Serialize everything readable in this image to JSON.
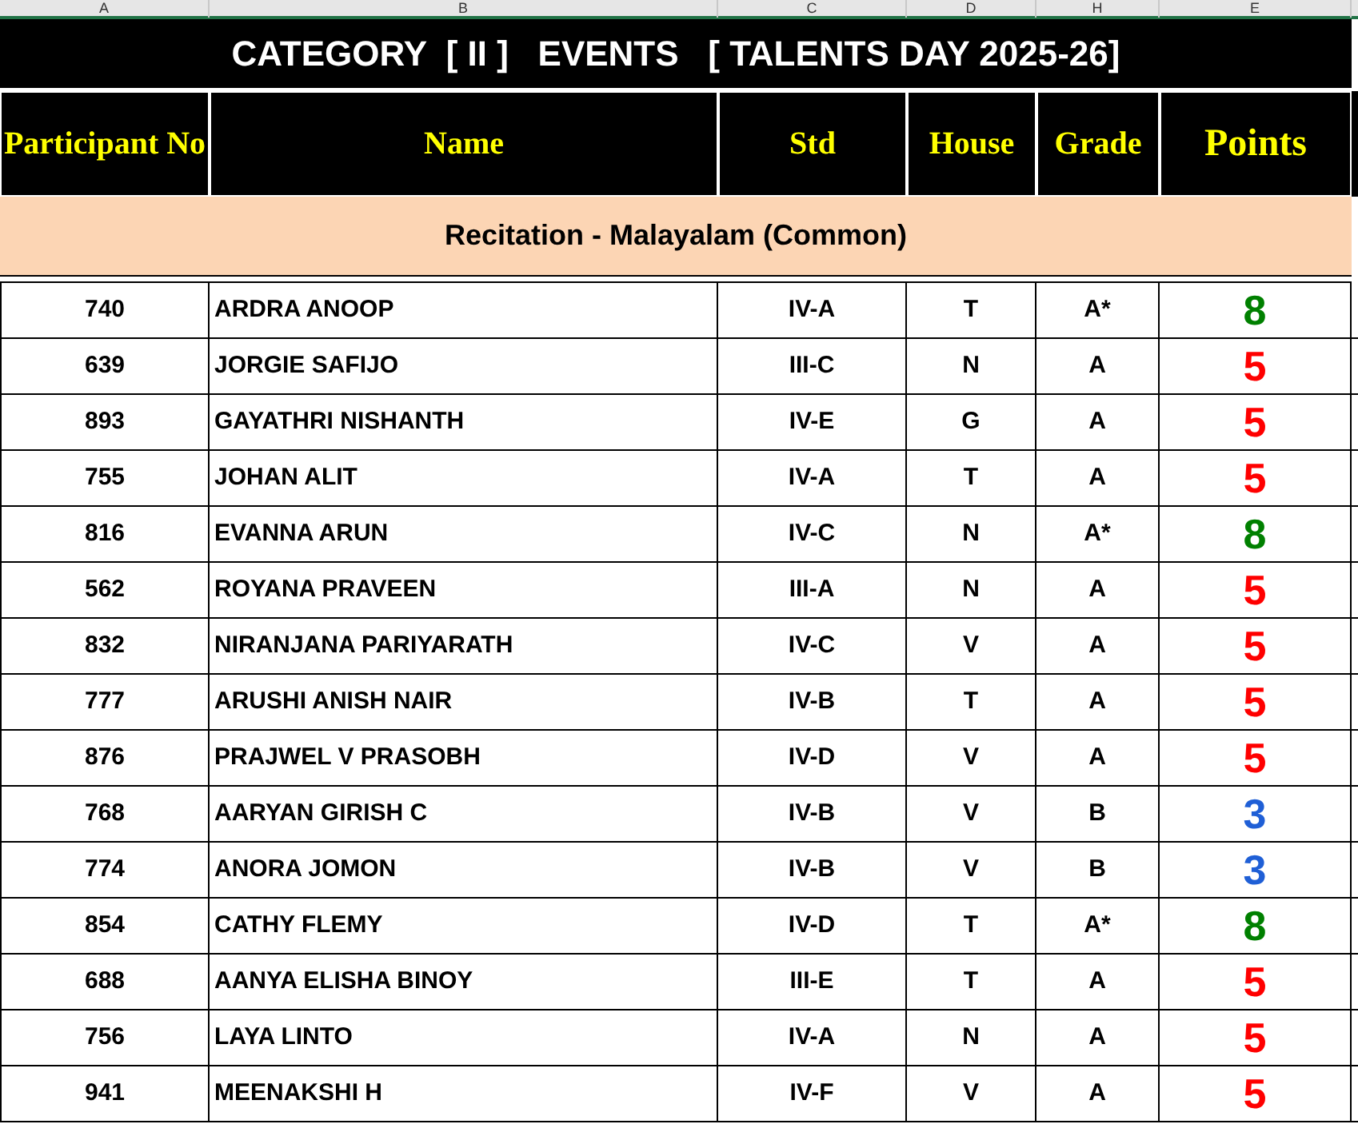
{
  "column_letters": [
    "A",
    "B",
    "C",
    "D",
    "H",
    "E"
  ],
  "title": "CATEGORY  [ II ]   EVENTS   [ TALENTS DAY 2025-26]",
  "columns": [
    "Participant No",
    "Name",
    "Std",
    "House",
    "Grade",
    "Points"
  ],
  "section": "Recitation - Malayalam (Common)",
  "rows": [
    {
      "no": "740",
      "name": "ARDRA ANOOP",
      "std": "IV-A",
      "house": "T",
      "grade": "A*",
      "points": "8",
      "color": "#008000"
    },
    {
      "no": "639",
      "name": "JORGIE SAFIJO",
      "std": "III-C",
      "house": "N",
      "grade": "A",
      "points": "5",
      "color": "#ff0000"
    },
    {
      "no": "893",
      "name": "GAYATHRI NISHANTH",
      "std": "IV-E",
      "house": "G",
      "grade": "A",
      "points": "5",
      "color": "#ff0000"
    },
    {
      "no": "755",
      "name": "JOHAN ALIT",
      "std": "IV-A",
      "house": "T",
      "grade": "A",
      "points": "5",
      "color": "#ff0000"
    },
    {
      "no": "816",
      "name": "EVANNA ARUN",
      "std": "IV-C",
      "house": "N",
      "grade": "A*",
      "points": "8",
      "color": "#008000"
    },
    {
      "no": "562",
      "name": "ROYANA PRAVEEN",
      "std": "III-A",
      "house": "N",
      "grade": "A",
      "points": "5",
      "color": "#ff0000"
    },
    {
      "no": "832",
      "name": "NIRANJANA PARIYARATH",
      "std": "IV-C",
      "house": "V",
      "grade": "A",
      "points": "5",
      "color": "#ff0000"
    },
    {
      "no": "777",
      "name": "ARUSHI ANISH NAIR",
      "std": "IV-B",
      "house": "T",
      "grade": "A",
      "points": "5",
      "color": "#ff0000"
    },
    {
      "no": "876",
      "name": "PRAJWEL V PRASOBH",
      "std": "IV-D",
      "house": "V",
      "grade": "A",
      "points": "5",
      "color": "#ff0000"
    },
    {
      "no": "768",
      "name": "AARYAN GIRISH C",
      "std": "IV-B",
      "house": "V",
      "grade": "B",
      "points": "3",
      "color": "#1f5fd6"
    },
    {
      "no": "774",
      "name": "ANORA JOMON",
      "std": "IV-B",
      "house": "V",
      "grade": "B",
      "points": "3",
      "color": "#1f5fd6"
    },
    {
      "no": "854",
      "name": "CATHY FLEMY",
      "std": "IV-D",
      "house": "T",
      "grade": "A*",
      "points": "8",
      "color": "#008000"
    },
    {
      "no": "688",
      "name": "AANYA ELISHA BINOY",
      "std": "III-E",
      "house": "T",
      "grade": "A",
      "points": "5",
      "color": "#ff0000"
    },
    {
      "no": "756",
      "name": "LAYA LINTO",
      "std": "IV-A",
      "house": "N",
      "grade": "A",
      "points": "5",
      "color": "#ff0000"
    },
    {
      "no": "941",
      "name": "MEENAKSHI H",
      "std": "IV-F",
      "house": "V",
      "grade": "A",
      "points": "5",
      "color": "#ff0000"
    }
  ]
}
